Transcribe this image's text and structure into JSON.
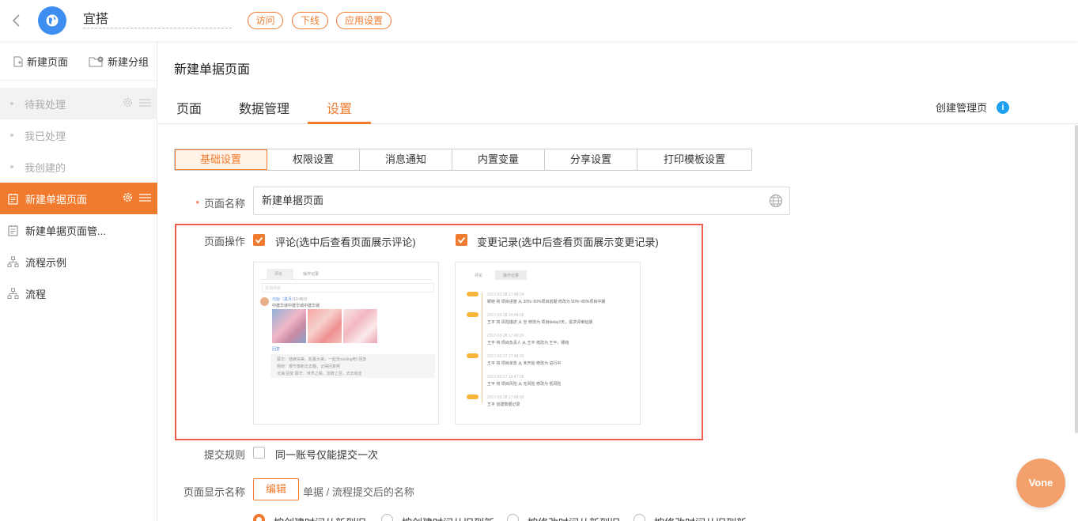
{
  "header": {
    "app_name": "宜搭",
    "buttons": [
      "访问",
      "下线",
      "应用设置"
    ]
  },
  "sidebar": {
    "actions": {
      "new_page": "新建页面",
      "new_group": "新建分组"
    },
    "items": [
      {
        "label": "待我处理"
      },
      {
        "label": "我已处理"
      },
      {
        "label": "我创建的"
      },
      {
        "label": "新建单据页面"
      },
      {
        "label": "新建单据页面管..."
      },
      {
        "label": "流程示例"
      },
      {
        "label": "流程"
      }
    ]
  },
  "main": {
    "title": "新建单据页面",
    "tabs": [
      "页面",
      "数据管理",
      "设置"
    ],
    "create_manage": "创建管理页",
    "subtabs": [
      "基础设置",
      "权限设置",
      "消息通知",
      "内置变量",
      "分享设置",
      "打印模板设置"
    ],
    "form": {
      "page_name_label": "页面名称",
      "page_name_value": "新建单据页面",
      "page_ops_label": "页面操作",
      "comment_option": "评论(选中后查看页面展示评论)",
      "changelog_option": "变更记录(选中后查看页面展示变更记录)",
      "submit_rule_label": "提交规则",
      "submit_rule_option": "同一账号仅能提交一次",
      "display_name_label": "页面显示名称",
      "edit_button": "编辑",
      "display_name_hint": "单据 / 流程提交后的名称"
    }
  },
  "preview_comment": {
    "tabs": [
      "评论",
      "操作记录"
    ],
    "placeholder": "添加评论",
    "user": "元始（其月）",
    "time": "10:45分",
    "text": "中建华城中建华城中建华城",
    "reply": "回复",
    "replies": [
      "蔡华：巷蜂完美，影蘸大美，一起去sosling吧! 回复",
      "杨晓：慢节奏断去去翻，记得回复啊",
      "法海 回复 蔡华：世界之殿，张蔚之至，去去就走"
    ]
  },
  "preview_changelog": {
    "tabs": [
      "评论",
      "操作记录"
    ],
    "entries": [
      {
        "time": "2017-03-28 17:48:24",
        "text": "颖晓 将 项目进度 从 30%~50%项目前期 修改为 50%~80%项目中期"
      },
      {
        "time": "2017-03-28 14:48:09",
        "text": "王平 将 风险描述 从 空 修改为 项目delay2天，需求评审延期"
      },
      {
        "time": "2017-03-28 17:48:20",
        "text": "王平 将 项目负责人 从 王平 修改为 王平，颖晓"
      },
      {
        "time": "2017-03-27 17:48:16",
        "text": "王平 将 项目状态 从 未开始 修改为 进行中"
      },
      {
        "time": "2017-03-27 16:47:06",
        "text": "王平 将 项目风险 从 无风险 修改为 低风险"
      },
      {
        "time": "2017-03-28 17:48:16",
        "text": "王平 创建数据记录"
      }
    ]
  },
  "radio_options": [
    "按创建时间从新到旧",
    "按创建时间从旧到新",
    "按修改时间从新到旧",
    "按修改时间从旧到新"
  ],
  "floating_button": "Vone",
  "colors": {
    "accent": "#f07a2d",
    "highlight_border": "#ee5c4d",
    "logo_blue": "#3d8ef0",
    "info_blue": "#1fa0f0"
  }
}
